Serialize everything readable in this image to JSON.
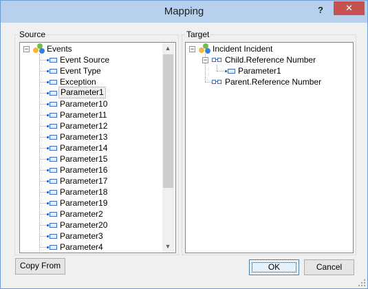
{
  "window": {
    "title": "Mapping",
    "help_label": "?",
    "close_label": "✕"
  },
  "source": {
    "label": "Source",
    "root": "Events",
    "items": [
      "Event Source",
      "Event Type",
      "Exception",
      "Parameter1",
      "Parameter10",
      "Parameter11",
      "Parameter12",
      "Parameter13",
      "Parameter14",
      "Parameter15",
      "Parameter16",
      "Parameter17",
      "Parameter18",
      "Parameter19",
      "Parameter2",
      "Parameter20",
      "Parameter3",
      "Parameter4"
    ],
    "selected_index": 3
  },
  "target": {
    "label": "Target",
    "root": "Incident Incident",
    "child": "Child.Reference Number",
    "grandchild": "Parameter1",
    "parent": "Parent.Reference Number"
  },
  "buttons": {
    "copy_from": "Copy From",
    "ok": "OK",
    "cancel": "Cancel"
  },
  "icons": {
    "expander_open": "⊟",
    "scroll_up": "▲",
    "scroll_down": "▼"
  }
}
